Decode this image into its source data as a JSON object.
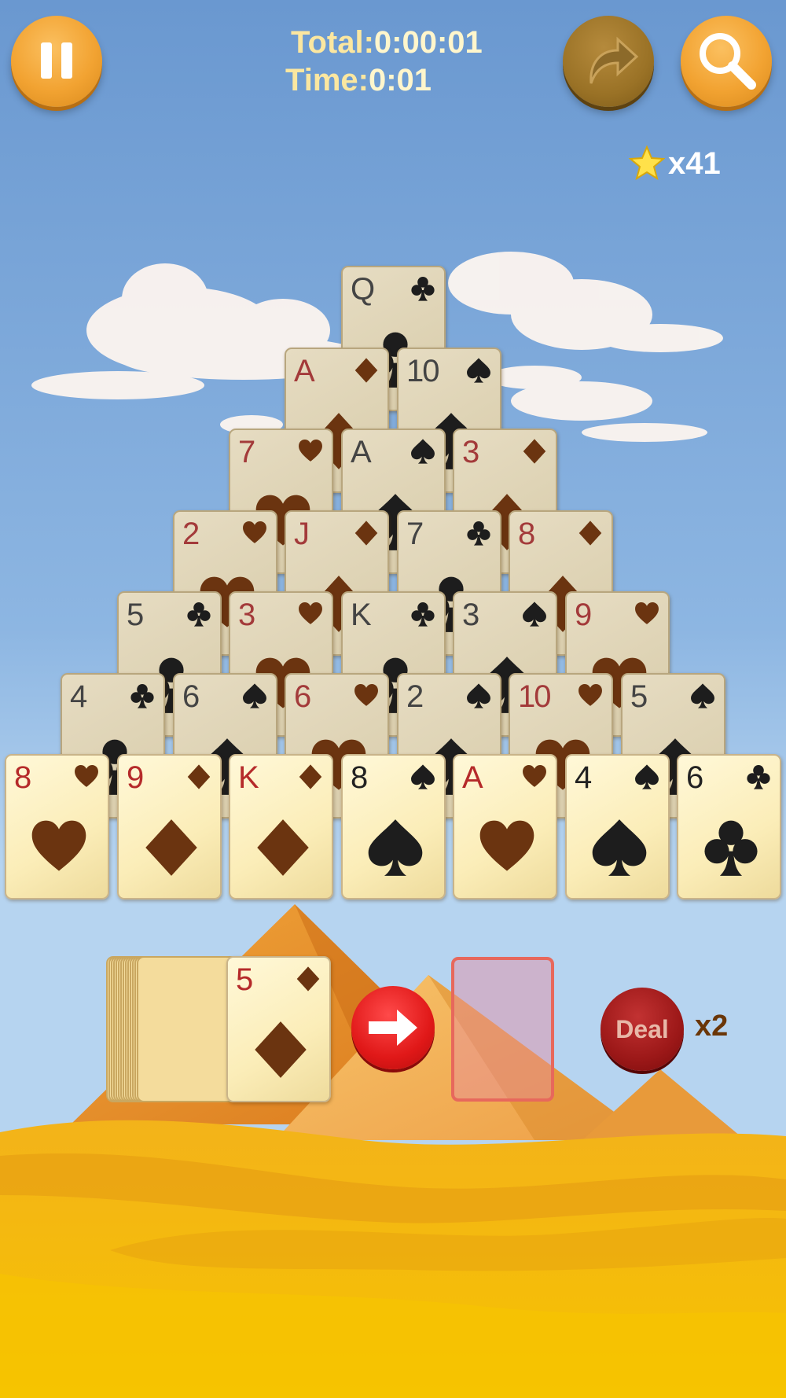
{
  "hud": {
    "total_label": "Total:",
    "total_value": "0:00:01",
    "time_label": "Time:",
    "time_value": "0:01",
    "stars_count": "x41"
  },
  "pyramid": [
    [
      {
        "rank": "Q",
        "suit": "clubs"
      }
    ],
    [
      {
        "rank": "A",
        "suit": "diamonds"
      },
      {
        "rank": "10",
        "suit": "spades"
      }
    ],
    [
      {
        "rank": "7",
        "suit": "hearts"
      },
      {
        "rank": "A",
        "suit": "spades"
      },
      {
        "rank": "3",
        "suit": "diamonds"
      }
    ],
    [
      {
        "rank": "2",
        "suit": "hearts"
      },
      {
        "rank": "J",
        "suit": "diamonds"
      },
      {
        "rank": "7",
        "suit": "clubs"
      },
      {
        "rank": "8",
        "suit": "diamonds"
      }
    ],
    [
      {
        "rank": "5",
        "suit": "clubs"
      },
      {
        "rank": "3",
        "suit": "hearts"
      },
      {
        "rank": "K",
        "suit": "clubs"
      },
      {
        "rank": "3",
        "suit": "spades"
      },
      {
        "rank": "9",
        "suit": "hearts"
      }
    ],
    [
      {
        "rank": "4",
        "suit": "clubs"
      },
      {
        "rank": "6",
        "suit": "spades"
      },
      {
        "rank": "6",
        "suit": "hearts"
      },
      {
        "rank": "2",
        "suit": "spades"
      },
      {
        "rank": "10",
        "suit": "hearts"
      },
      {
        "rank": "5",
        "suit": "spades"
      }
    ],
    [
      {
        "rank": "8",
        "suit": "hearts"
      },
      {
        "rank": "9",
        "suit": "diamonds"
      },
      {
        "rank": "K",
        "suit": "diamonds"
      },
      {
        "rank": "8",
        "suit": "spades"
      },
      {
        "rank": "A",
        "suit": "hearts"
      },
      {
        "rank": "4",
        "suit": "spades"
      },
      {
        "rank": "6",
        "suit": "clubs"
      }
    ]
  ],
  "waste_card": {
    "rank": "5",
    "suit": "diamonds"
  },
  "deal": {
    "label": "Deal",
    "count": "x2"
  },
  "colors": {
    "sky": "#6b9bd3",
    "sand": "#f5b90a",
    "button_orange": "#f2a332",
    "red_suit": "#b52a2a",
    "brown_suit": "#6b3410"
  }
}
